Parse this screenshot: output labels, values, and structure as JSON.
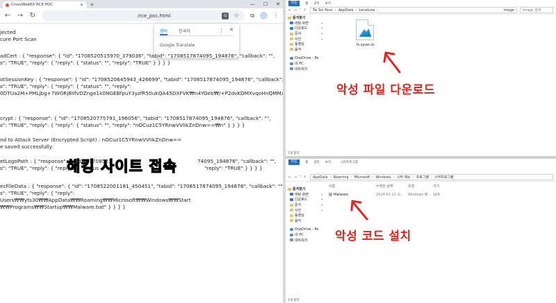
{
  "browser": {
    "tab_title": "CrossWebEX RCE POC",
    "url": "/rce_poc.html",
    "translate": {
      "lang_1": "영어",
      "lang_2": "한국어",
      "brand": "Google Translate"
    },
    "content_lines": [
      "jected",
      "cure Port Scan",
      "adCert : { \"response\": { \"id\": \"1708520515970_379036\", \"tabid\": \"1708517874095_194876\", \"callback\": \"\",",
      "s\": \"TRUE\", \"reply\": { \"reply\": { \"status\": \"\", \"reply\": \"TRUE\" } } } }",
      "otSessionKey : { \"response\": { \"id\": \"1708520645943_426699\", \"tabid\": \"1708517874095_194876\", \"callback\": \"\",",
      "s\": \"TRUE\", \"reply\": { \"reply\": { \"status\": \"\", \"reply\":",
      "0DTUa2M+PMLjbg+7WGRj8IlfvDZnge1k0NGEBfpuY3yzfR5tlukQA45DXFVK₩n4YOeb₩/+P2dvKOMXvqoHnQMMxxm",
      "crypt : { \"response\": { \"id\": \"1708520775791_196056\", \"tabid\": \"1708517874095_194876\", \"callback\": \"\",",
      "s\": \"TRUE\", \"reply\": { \"reply\": { \"status\": \"\", \"reply\": \"nOCuz1C5YRnwVVlikZnDnw==₩n\" } } } }",
      "nd to Attack Server (Encrypted Script) : nOCuz1C5YRnwVVlikZnDnw==",
      "e saved successfully.",
      "etLogoPath : { \"response\": { \"id\": \"1708521",
      "s\": \"TRUE\", \"reply\": { \"reply\": { \"status",
      "ecFileData : { \"response\": { \"id\": \"1708522001181_450451\", \"tabid\": \"1708517874095_194876\", \"callback\": \"\",",
      "s\": \"TRUE\", \"reply\": { \"reply\":",
      "Users₩₩yts30₩₩AppData₩₩Roaming₩₩Microsoft₩₩Windows₩₩Start",
      "₩₩Programs₩₩Startup₩₩Malware.bat\" } } } }"
    ],
    "content_line_tail_logo": "74095_194876\", \"callback\": \"\",",
    "content_line_tail_logo2": "\"reply\": \"TRUE\" } } } }",
    "overlay_text": "해킹 사이트 접속"
  },
  "explorer_top": {
    "ribbon": [
      "파일",
      "홈",
      "공유",
      "보기"
    ],
    "path": [
      "Tai Sic Youn",
      "AppData",
      "LocalLow"
    ],
    "search_placeholder": "image 검색",
    "folder_label": "image",
    "nav": [
      {
        "label": "즐겨찾기",
        "type": "head"
      },
      {
        "label": "바탕 화면",
        "type": "blue",
        "pin": "📌"
      },
      {
        "label": "다운로드",
        "type": "blue",
        "pin": "📌"
      },
      {
        "label": "문서",
        "type": "folder",
        "pin": "📌"
      },
      {
        "label": "사진",
        "type": "folder",
        "pin": "📌"
      },
      {
        "label": "동영상",
        "type": "folder",
        "pin": ""
      },
      {
        "label": "음악",
        "type": "folder",
        "pin": ""
      },
      {
        "label": "",
        "type": "gap"
      },
      {
        "label": "OneDrive - Pe",
        "type": "cloud"
      },
      {
        "label": "내 PC",
        "type": "pc"
      },
      {
        "label": "네트워크",
        "type": "net"
      }
    ],
    "file_name": "fs.sysec.kr",
    "status": "1개 항목"
  },
  "explorer_bottom": {
    "ribbon": [
      "파일",
      "홈",
      "공유",
      "보기"
    ],
    "path": [
      "AppData",
      "Roaming",
      "Microsoft",
      "Windows",
      "시작 메뉴",
      "프로그램",
      "시작프로그램"
    ],
    "title": "시작프로그램",
    "nav": [
      {
        "label": "즐겨찾기",
        "type": "head"
      },
      {
        "label": "바탕 화면",
        "type": "blue",
        "pin": "📌"
      },
      {
        "label": "다운로드",
        "type": "blue",
        "pin": "📌"
      },
      {
        "label": "문서",
        "type": "folder",
        "pin": "📌"
      },
      {
        "label": "사진",
        "type": "folder",
        "pin": "📌"
      },
      {
        "label": "동영상",
        "type": "folder",
        "pin": ""
      },
      {
        "label": "음악",
        "type": "folder",
        "pin": ""
      },
      {
        "label": "",
        "type": "gap"
      },
      {
        "label": "OneDrive - Pe",
        "type": "cloud"
      },
      {
        "label": "내 PC",
        "type": "pc"
      },
      {
        "label": "네트워크",
        "type": "net"
      }
    ],
    "columns": [
      "이름",
      "수정한 날짜",
      "유형",
      "크기"
    ],
    "rows": [
      {
        "name": "Malware",
        "date": "2024-01-11 오...",
        "type": "Windows 배...",
        "size": "1KB"
      }
    ],
    "status": "1개 항목"
  },
  "captions": {
    "download": "악성 파일 다운로드",
    "install": "악성 코드 설치"
  },
  "colors": {
    "caption_red": "#e8211b",
    "explorer_blue": "#1f6fc5"
  }
}
